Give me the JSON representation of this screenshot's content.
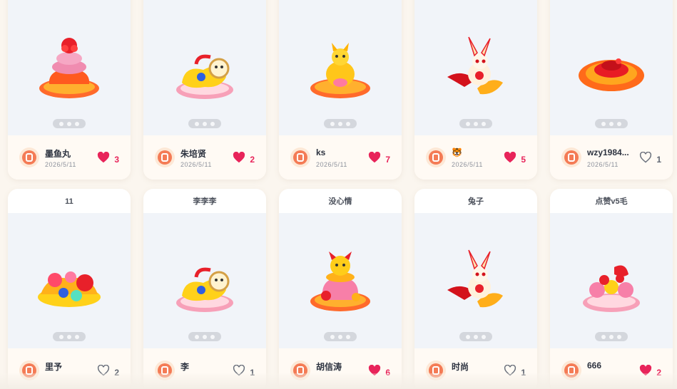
{
  "cards": [
    {
      "title": "",
      "user": "墨鱼丸",
      "date": "2026/5/11",
      "likes": "3",
      "liked": true,
      "art": "lantern-cake"
    },
    {
      "title": "",
      "user": "朱培贤",
      "date": "2026/5/11",
      "likes": "2",
      "liked": true,
      "art": "lion-dance"
    },
    {
      "title": "",
      "user": "ks",
      "date": "2026/5/11",
      "likes": "7",
      "liked": true,
      "art": "golden-horse"
    },
    {
      "title": "",
      "user": "🐯",
      "date": "2026/5/11",
      "likes": "5",
      "liked": true,
      "art": "rabbit-fish"
    },
    {
      "title": "",
      "user": "wzy1984...",
      "date": "2026/5/11",
      "likes": "1",
      "liked": false,
      "art": "red-flower-plate"
    },
    {
      "title": "11",
      "user": "里予",
      "date": "",
      "likes": "2",
      "liked": false,
      "art": "flower-basket"
    },
    {
      "title": "李李李",
      "user": "李",
      "date": "",
      "likes": "1",
      "liked": false,
      "art": "lion-dance-2"
    },
    {
      "title": "没心情",
      "user": "胡信涛",
      "date": "",
      "likes": "6",
      "liked": true,
      "art": "lucky-bag"
    },
    {
      "title": "兔子",
      "user": "时尚",
      "date": "",
      "likes": "1",
      "liked": false,
      "art": "rabbit-fish-2"
    },
    {
      "title": "点赞v5毛",
      "user": "666",
      "date": "",
      "likes": "2",
      "liked": true,
      "art": "blossom-tray"
    }
  ],
  "colors": {
    "accent": "#e8245a",
    "page_bg": "#fbf6ef",
    "art_bg": "#f1f4f9"
  }
}
